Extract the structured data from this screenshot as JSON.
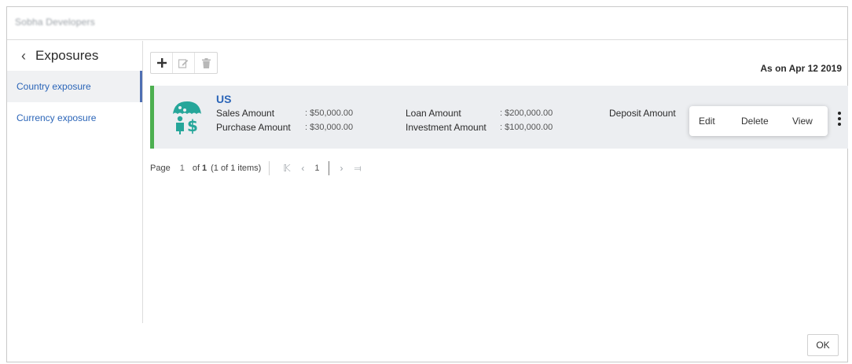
{
  "window": {
    "title": "Sobha Developers"
  },
  "sidebar": {
    "header": "Exposures",
    "back_icon": "chevron-left-icon",
    "items": [
      {
        "label": "Country exposure",
        "active": true
      },
      {
        "label": "Currency exposure",
        "active": false
      }
    ]
  },
  "toolbar": {
    "buttons": [
      {
        "icon": "plus-icon"
      },
      {
        "icon": "edit-icon"
      },
      {
        "icon": "trash-icon"
      }
    ]
  },
  "as_on": "As on Apr 12 2019",
  "record": {
    "title": "US",
    "icon": "umbrella-dollar-icon",
    "accent_color": "#4caf50",
    "icon_color": "#26a69a",
    "fields": {
      "sales_amount_label": "Sales Amount",
      "sales_amount_value": ": $50,000.00",
      "purchase_amount_label": "Purchase Amount",
      "purchase_amount_value": ": $30,000.00",
      "loan_amount_label": "Loan Amount",
      "loan_amount_value": ": $200,000.00",
      "investment_amount_label": "Investment Amount",
      "investment_amount_value": ": $100,000.00",
      "deposit_amount_label": "Deposit Amount"
    }
  },
  "context_menu": {
    "edit": "Edit",
    "delete": "Delete",
    "view": "View"
  },
  "pagination": {
    "page_label": "Page",
    "current_page": "1",
    "of_label": "of",
    "total_pages": "1",
    "items_info": "(1 of 1 items)",
    "page_number": "1"
  },
  "footer": {
    "ok_label": "OK"
  },
  "colors": {
    "link": "#2b65b8",
    "active_border": "#4f6fb3"
  }
}
